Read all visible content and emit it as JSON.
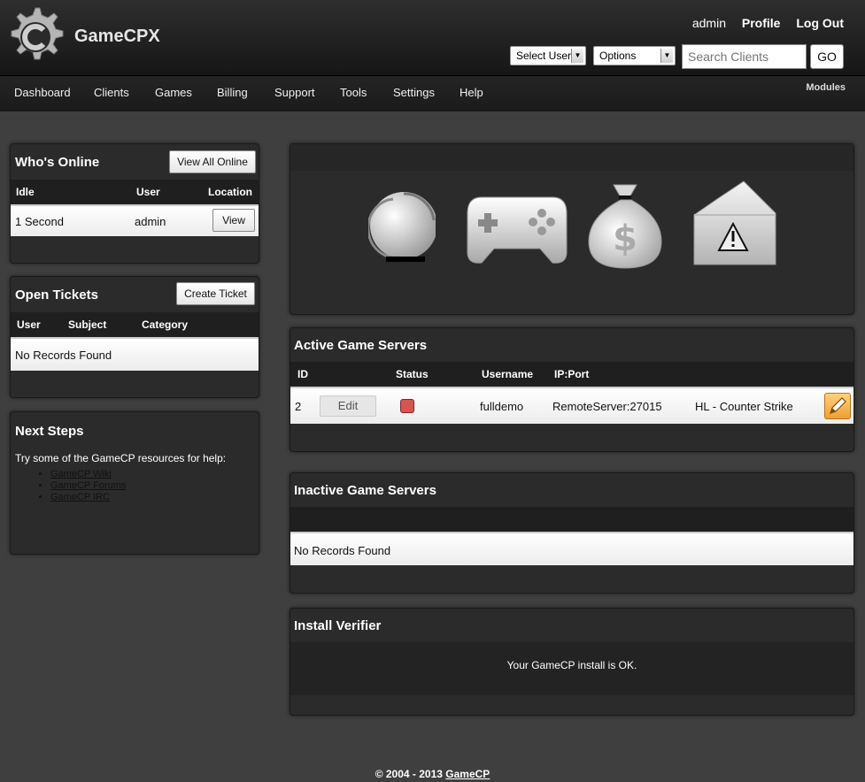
{
  "header": {
    "brand": "GameCPX",
    "user": "admin",
    "profile": "Profile",
    "logout": "Log Out",
    "select_user": "Select User",
    "options": "Options",
    "search_placeholder": "Search Clients",
    "go": "GO"
  },
  "nav": {
    "items": [
      "Dashboard",
      "Clients",
      "Games",
      "Billing",
      "Support",
      "Tools",
      "Settings",
      "Help"
    ],
    "modules": "Modules"
  },
  "whos_online": {
    "title": "Who's Online",
    "button": "View All Online",
    "columns": [
      "Idle",
      "User",
      "Location"
    ],
    "rows": [
      {
        "idle": "1 Second",
        "user": "admin",
        "action": "View"
      }
    ]
  },
  "open_tickets": {
    "title": "Open Tickets",
    "button": "Create Ticket",
    "columns": [
      "User",
      "Subject",
      "Category"
    ],
    "empty": "No Records Found"
  },
  "next_steps": {
    "title": "Next Steps",
    "intro": "Try some of the GameCP resources for help:",
    "links": [
      "GameCP Wiki",
      "GameCP Forums",
      "GameCP IRC"
    ]
  },
  "icons": [
    "helmet-icon",
    "gamepad-icon",
    "money-bag-icon",
    "warning-ticket-icon"
  ],
  "active_servers": {
    "title": "Active Game Servers",
    "columns": [
      "ID",
      "Status",
      "Username",
      "IP:Port"
    ],
    "rows": [
      {
        "id": "2",
        "edit": "Edit",
        "status_color": "#d9534f",
        "username": "fulldemo",
        "ip_port": "RemoteServer:27015",
        "game": "HL - Counter Strike"
      }
    ]
  },
  "inactive_servers": {
    "title": "Inactive Game Servers",
    "empty": "No Records Found"
  },
  "install_verifier": {
    "title": "Install Verifier",
    "message": "Your GameCP install is OK."
  },
  "footer": {
    "text": "© 2004 - 2013",
    "link": "GameCP"
  }
}
